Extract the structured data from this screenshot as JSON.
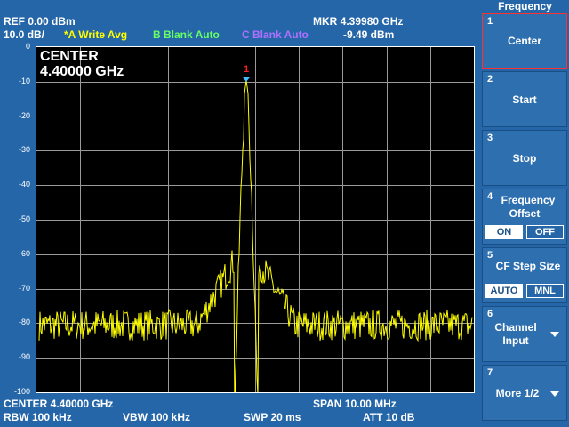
{
  "header": {
    "ref": "REF  0.00 dBm",
    "scale": "10.0 dB/",
    "trace_a": "*A Write Avg",
    "trace_b": "B Blank Auto",
    "trace_c": "C Blank Auto",
    "mkr_freq": "MKR  4.39980 GHz",
    "mkr_level": "-9.49 dBm"
  },
  "plot": {
    "center_label": "CENTER",
    "center_value": "4.40000 GHz",
    "marker_label": "1",
    "y_ticks": [
      "0",
      "-10",
      "-20",
      "-30",
      "-40",
      "-50",
      "-60",
      "-70",
      "-80",
      "-90",
      "-100"
    ]
  },
  "footer": {
    "center": "CENTER 4.40000 GHz",
    "span": "SPAN 10.00 MHz",
    "rbw": "RBW  100 kHz",
    "vbw": "VBW  100 kHz",
    "swp": "SWP  20 ms",
    "att": "ATT  10 dB"
  },
  "softkeys": {
    "title": "Frequency",
    "k1": {
      "num": "1",
      "label": "Center"
    },
    "k2": {
      "num": "2",
      "label": "Start"
    },
    "k3": {
      "num": "3",
      "label": "Stop"
    },
    "k4": {
      "num": "4",
      "label1": "Frequency",
      "label2": "Offset",
      "on": "ON",
      "off": "OFF"
    },
    "k5": {
      "num": "5",
      "label": "CF Step Size",
      "auto": "AUTO",
      "mnl": "MNL"
    },
    "k6": {
      "num": "6",
      "label1": "Channel",
      "label2": "Input"
    },
    "k7": {
      "num": "7",
      "label": "More 1/2"
    }
  },
  "colors": {
    "trace": "#ffff00",
    "trace_b": "#66ff66",
    "trace_c": "#b070ff",
    "marker": "#ff2020",
    "marker_point": "#40c0ff"
  }
}
